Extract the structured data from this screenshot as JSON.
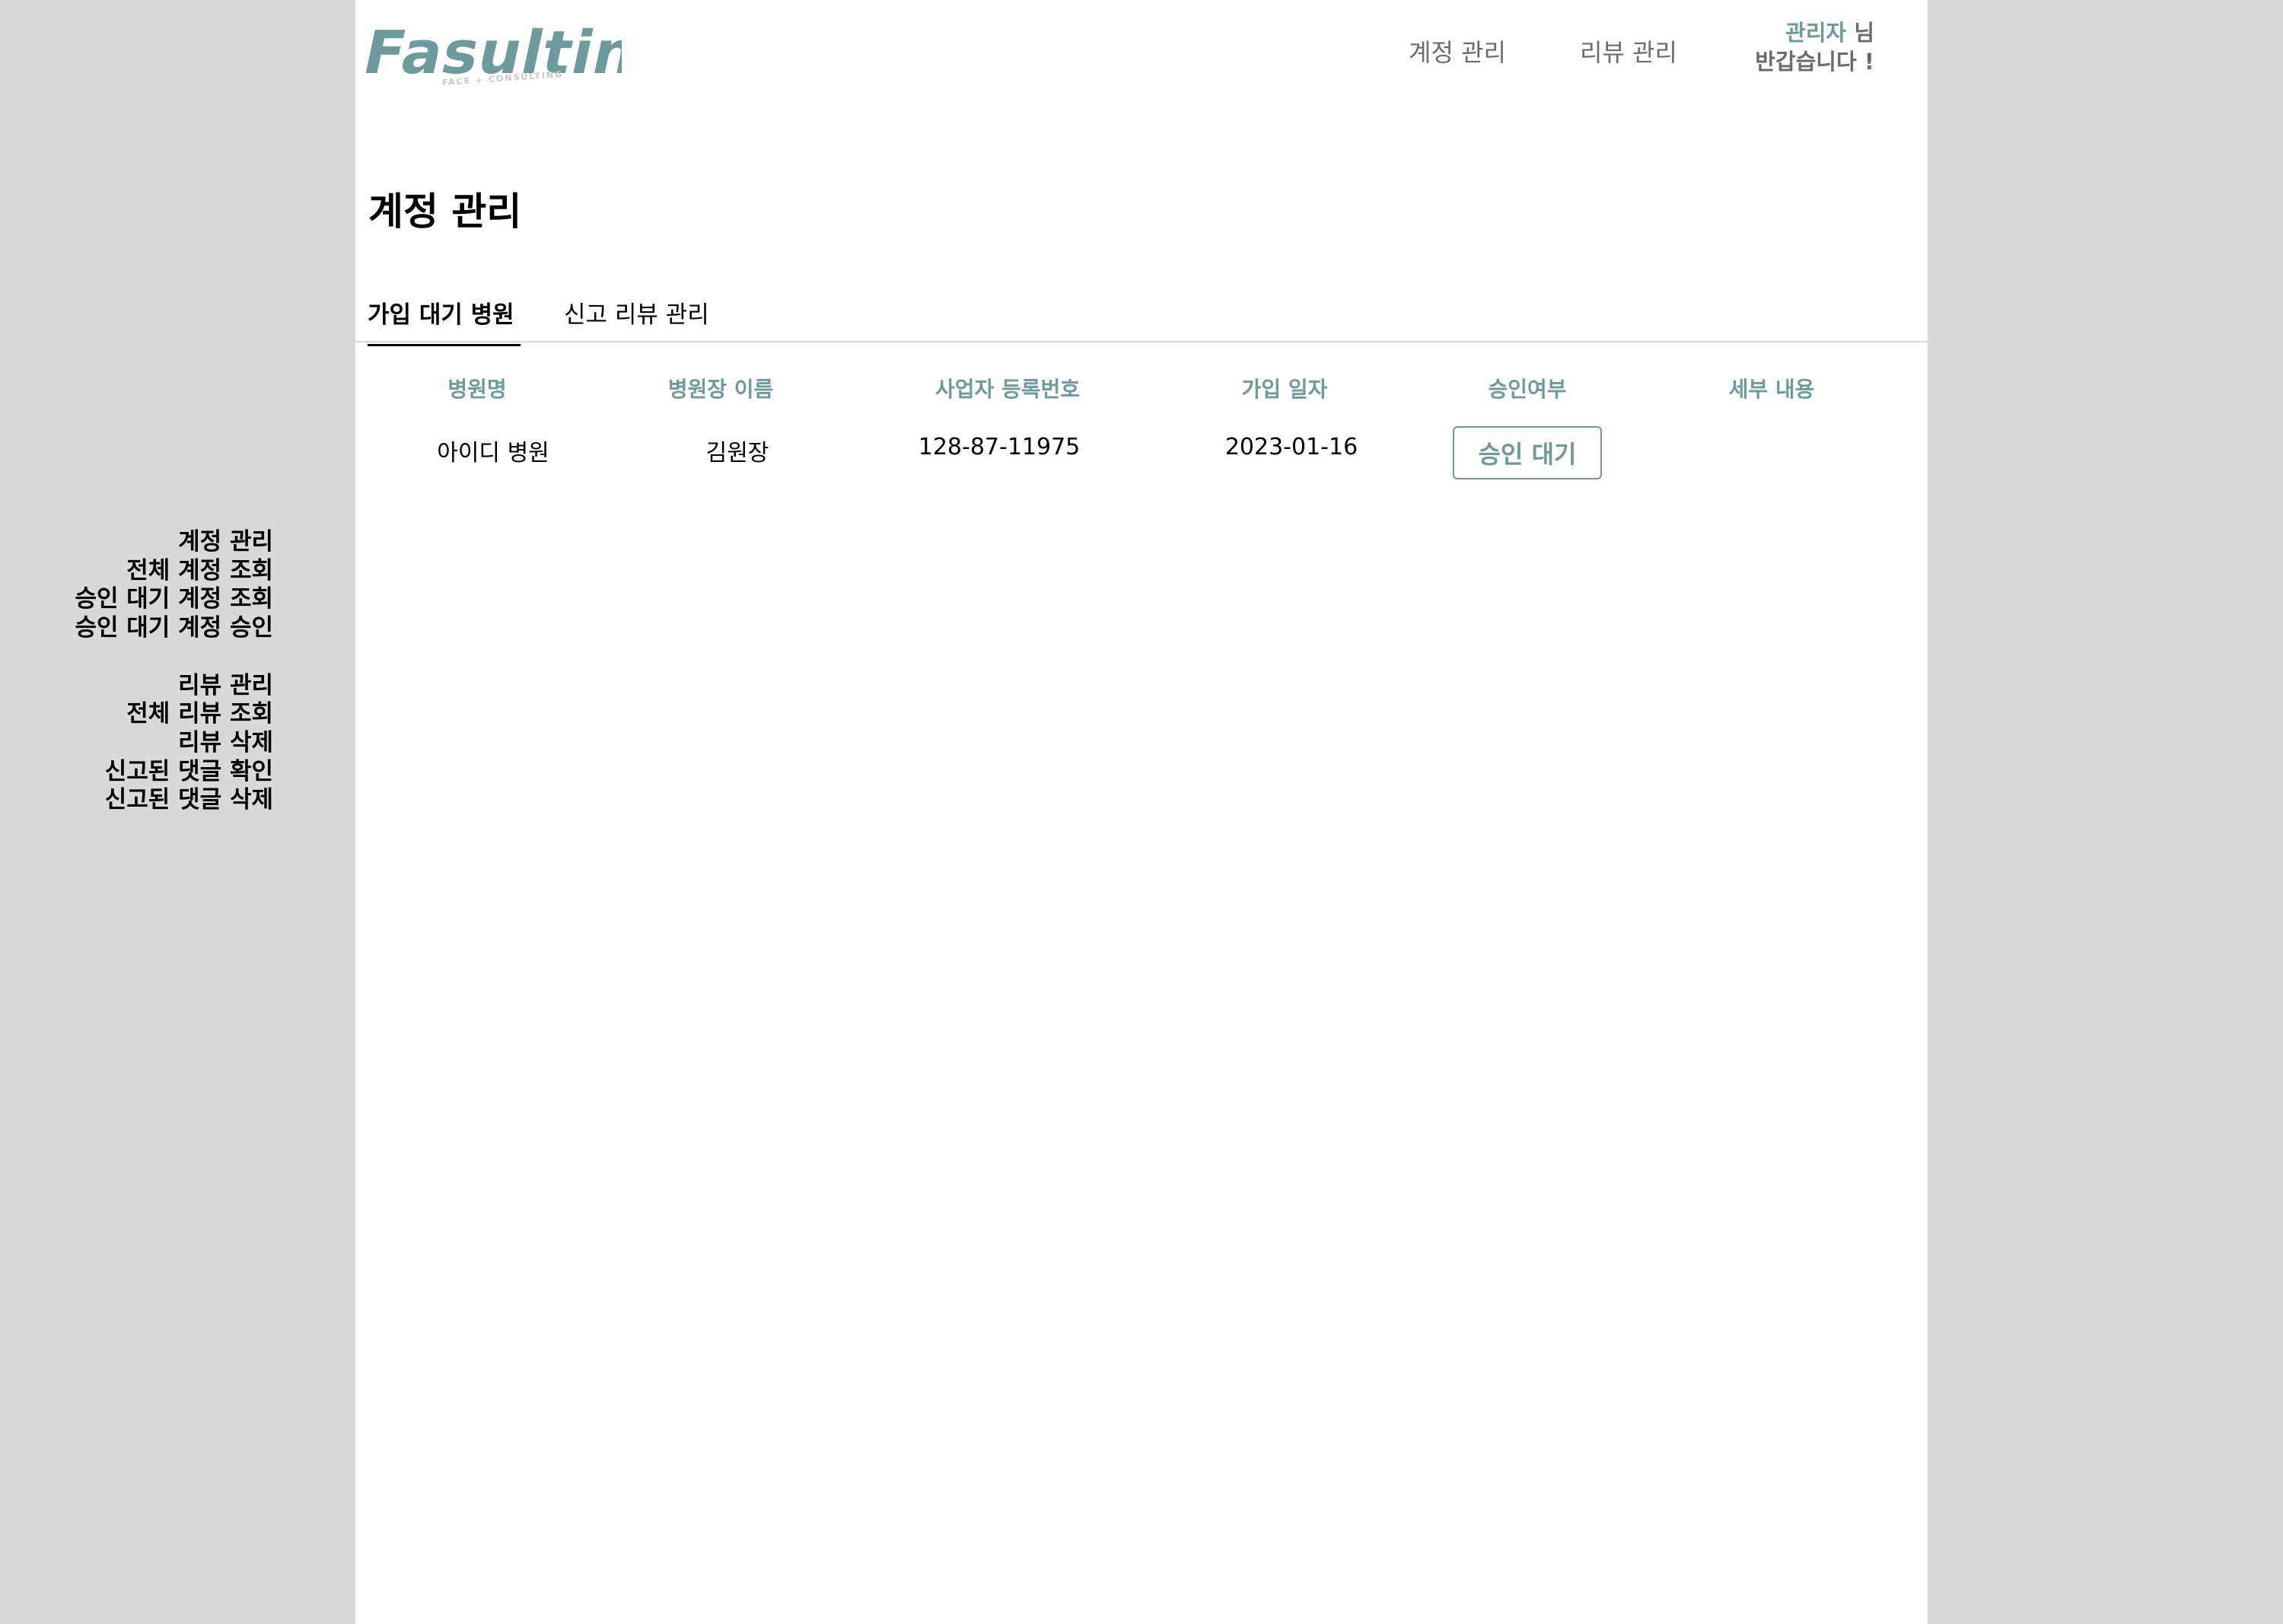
{
  "brand": {
    "name": "Fasulting",
    "tagline": "FACE + CONSULTING",
    "color": "#6c9a9d"
  },
  "sidebar": {
    "groups": [
      {
        "heading": "계정 관리",
        "items": [
          "전체 계정 조회",
          "승인 대기 계정 조회",
          "승인 대기 계정 승인"
        ]
      },
      {
        "heading": "리뷰 관리",
        "items": [
          "전체 리뷰 조회",
          "리뷰 삭제",
          "신고된 댓글 확인",
          "신고된 댓글 삭제"
        ]
      }
    ]
  },
  "header": {
    "nav": [
      "계정 관리",
      "리뷰 관리"
    ],
    "greeting": {
      "role": "관리자",
      "suffix": " 님",
      "message": "반갑습니다 !"
    }
  },
  "main": {
    "title": "계정 관리",
    "tabs": [
      {
        "label": "가입 대기 병원",
        "active": true
      },
      {
        "label": "신고 리뷰 관리",
        "active": false
      }
    ],
    "table": {
      "columns": [
        "병원명",
        "병원장 이름",
        "사업자 등록번호",
        "가입 일자",
        "승인여부",
        "세부 내용"
      ],
      "rows": [
        {
          "hospital_name": "아이디 병원",
          "director_name": "김원장",
          "business_number": "128-87-11975",
          "join_date": "2023-01-16",
          "status": "승인 대기",
          "details": ""
        }
      ]
    }
  }
}
